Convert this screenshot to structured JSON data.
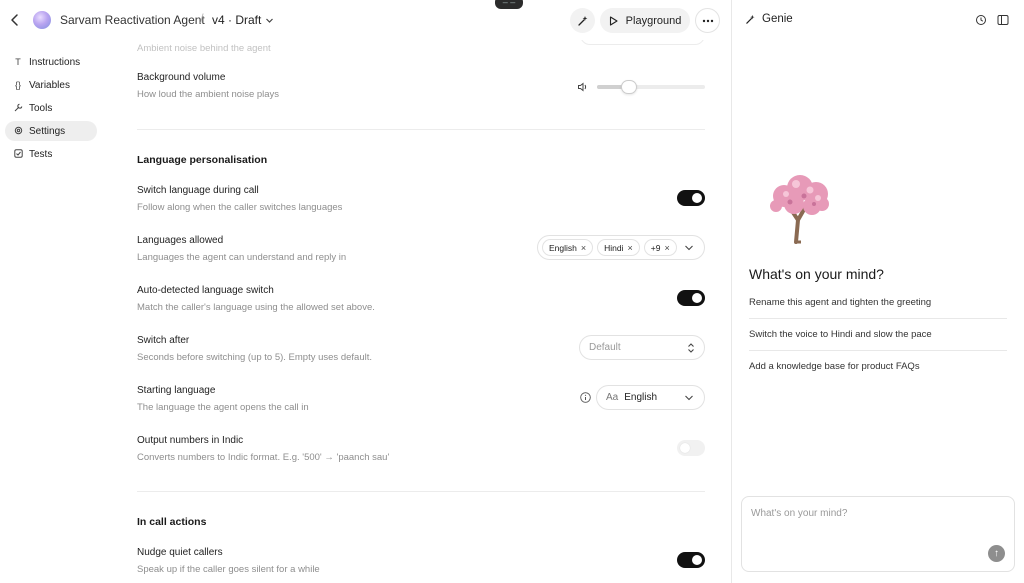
{
  "header": {
    "agent_name": "Sarvam Reactivation Agent",
    "separator": "/",
    "version": "v4 · Draft",
    "playground_label": "Playground"
  },
  "sidebar": {
    "items": [
      {
        "label": "Instructions",
        "icon": "text-icon"
      },
      {
        "label": "Variables",
        "icon": "braces-icon"
      },
      {
        "label": "Tools",
        "icon": "wrench-icon"
      },
      {
        "label": "Settings",
        "icon": "gear-icon",
        "active": true
      },
      {
        "label": "Tests",
        "icon": "checkbox-icon"
      }
    ]
  },
  "settings": {
    "ambient_desc_partial": "Ambient noise behind the agent",
    "background_volume": {
      "title": "Background volume",
      "desc": "How loud the ambient noise plays",
      "level": 0.3
    },
    "language_section": "Language personalisation",
    "switch_language": {
      "title": "Switch language during call",
      "desc": "Follow along when the caller switches languages",
      "enabled": true
    },
    "languages_allowed": {
      "title": "Languages allowed",
      "desc": "Languages the agent can understand and reply in",
      "chips": [
        "English",
        "Hindi",
        "+9"
      ]
    },
    "auto_switch": {
      "title": "Auto-detected language switch",
      "desc": "Match the caller's language using the allowed set above.",
      "enabled": true
    },
    "switch_after": {
      "title": "Switch after",
      "desc": "Seconds before switching (up to 5). Empty uses default.",
      "placeholder": "Default"
    },
    "starting_language": {
      "title": "Starting language",
      "desc": "The language the agent opens the call in",
      "icon_text": "Aa",
      "value": "English"
    },
    "output_numbers": {
      "title": "Output numbers in Indic",
      "desc": "Converts numbers to Indic format. E.g. '500' → 'paanch sau'",
      "enabled": false
    },
    "call_actions_section": "In call actions",
    "nudge": {
      "title": "Nudge quiet callers",
      "desc": "Speak up if the caller goes silent for a while",
      "enabled": true
    }
  },
  "genie": {
    "title": "Genie",
    "heading": "What's on your mind?",
    "suggestions": [
      "Rename this agent and tighten the greeting",
      "Switch the voice to Hindi and slow the pace",
      "Add a knowledge base for product FAQs"
    ],
    "input_placeholder": "What's on your mind?"
  },
  "colors": {
    "toggle_on": "#111111",
    "active_nav_bg": "#eeeeee",
    "tree_pink": "#e79ab8",
    "tree_trunk": "#8a6a52"
  }
}
